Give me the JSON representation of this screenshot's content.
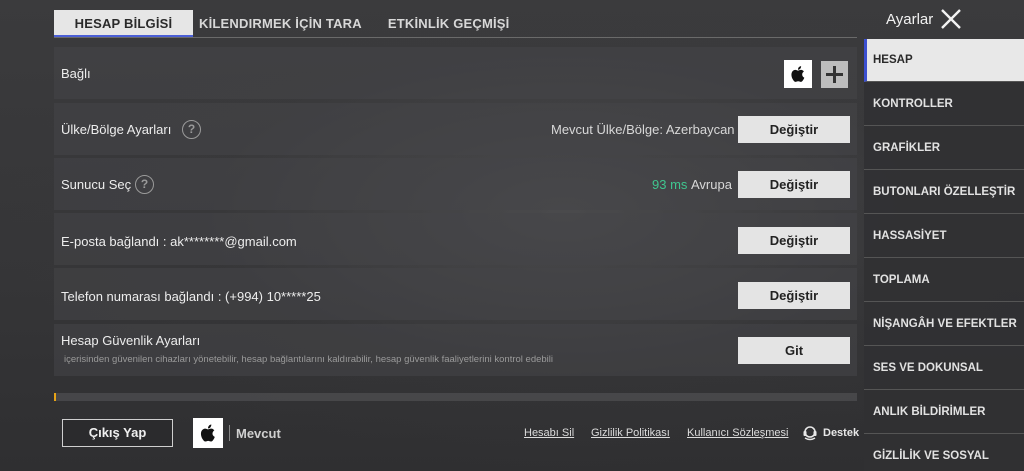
{
  "tabs": [
    {
      "label": "HESAP BİLGİSİ"
    },
    {
      "label": "KİLENDIRMEK İÇİN TARA"
    },
    {
      "label": "ETKİNLİK GEÇMİŞİ"
    }
  ],
  "rows": {
    "linked": {
      "label": "Bağlı"
    },
    "region": {
      "label": "Ülke/Bölge Ayarları",
      "current": "Mevcut Ülke/Bölge: Azerbaycan",
      "button": "Değiştir"
    },
    "server": {
      "label": "Sunucu Seç",
      "ping": "93 ms",
      "server_name": "Avrupa",
      "button": "Değiştir"
    },
    "email": {
      "label": "E-posta bağlandı : ak********@gmail.com",
      "button": "Değiştir"
    },
    "phone": {
      "label": "Telefon numarası bağlandı : (+994) 10*****25",
      "button": "Değiştir"
    },
    "security": {
      "label": "Hesap Güvenlik Ayarları",
      "desc": "içerisinden güvenilen cihazları yönetebilir, hesap bağlantılarını kaldırabilir, hesap güvenlik faaliyetlerini kontrol edebili",
      "button": "Git"
    }
  },
  "footer": {
    "logout": "Çıkış Yap",
    "current": "Mevcut",
    "links": [
      "Hesabı Sil",
      "Gizlilik Politikası",
      "Kullanıcı Sözleşmesi"
    ],
    "support": "Destek"
  },
  "sidebar": {
    "title": "Ayarlar",
    "items": [
      {
        "label": "HESAP"
      },
      {
        "label": "KONTROLLER"
      },
      {
        "label": "GRAFİKLER"
      },
      {
        "label": "BUTONLARI ÖZELLEŞTİR"
      },
      {
        "label": "HASSASİYET"
      },
      {
        "label": "TOPLAMA"
      },
      {
        "label": "NİŞANGÂH VE EFEKTLER"
      },
      {
        "label": "SES VE DOKUNSAL"
      },
      {
        "label": "ANLIK BİLDİRİMLER"
      },
      {
        "label": "GİZLİLİK VE SOSYAL"
      }
    ]
  },
  "colors": {
    "accent": "#3b4fd0",
    "ping_green": "#3fc58f",
    "progress": "#e6a317"
  }
}
